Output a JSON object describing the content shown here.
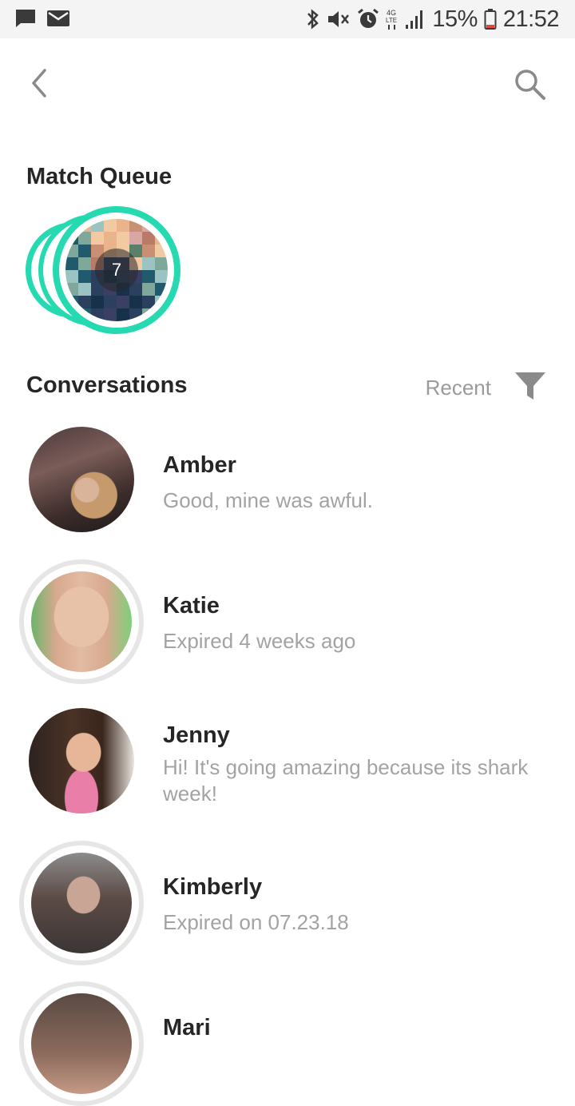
{
  "status_bar": {
    "battery": "15%",
    "time": "21:52",
    "network": "4G LTE",
    "left_icons": [
      "message-icon",
      "mail-icon"
    ],
    "right_icons": [
      "bluetooth-icon",
      "vibrate-icon",
      "alarm-icon",
      "signal-icon",
      "battery-icon"
    ]
  },
  "nav": {
    "back_icon": "chevron-left-icon",
    "search_icon": "search-icon"
  },
  "match_queue": {
    "title": "Match Queue",
    "count": "7",
    "accent_color": "#25d9b0"
  },
  "conversations": {
    "title": "Conversations",
    "sort_label": "Recent",
    "filter_icon": "filter-icon",
    "items": [
      {
        "name": "Amber",
        "message": "Good, mine was awful.",
        "expired": false
      },
      {
        "name": "Katie",
        "message": "Expired 4 weeks ago",
        "expired": true
      },
      {
        "name": "Jenny",
        "message": "Hi! It's going amazing because its shark week!",
        "expired": false
      },
      {
        "name": "Kimberly",
        "message": "Expired on 07.23.18",
        "expired": true
      },
      {
        "name": "Mari",
        "message": "",
        "expired": true
      }
    ]
  }
}
